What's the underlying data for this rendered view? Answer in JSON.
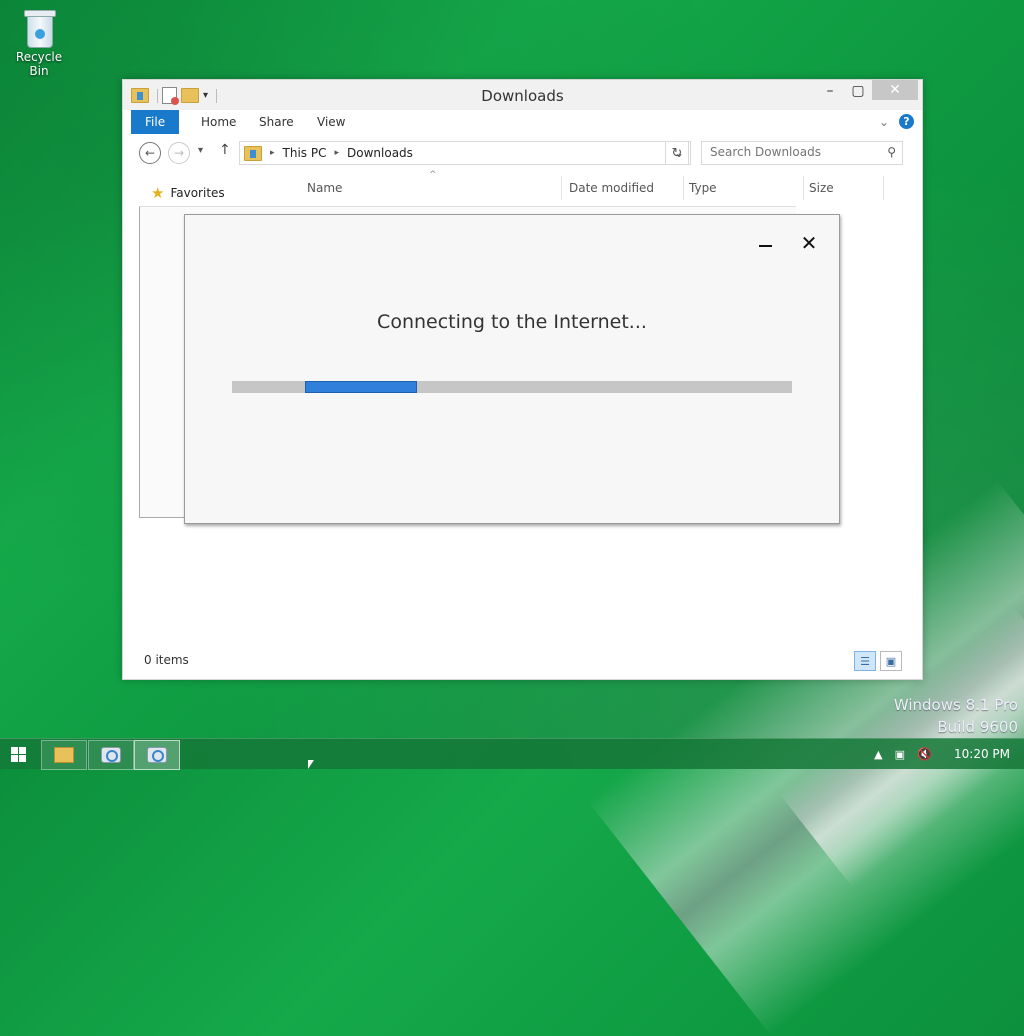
{
  "desktop": {
    "recycle_bin_label": "Recycle Bin",
    "watermark": [
      "Windows 8.1 Pro",
      "Build 9600"
    ]
  },
  "explorer": {
    "title": "Downloads",
    "tabs": {
      "file": "File",
      "home": "Home",
      "share": "Share",
      "view": "View"
    },
    "address": {
      "crumbs": [
        "This PC",
        "Downloads"
      ]
    },
    "search_placeholder": "Search Downloads",
    "nav": {
      "favorites": "Favorites"
    },
    "columns": [
      "Name",
      "Date modified",
      "Type",
      "Size"
    ],
    "status": "0 items"
  },
  "dialog": {
    "message": "Connecting to the Internet...",
    "progress": {
      "start": 0.13,
      "end": 0.33
    },
    "accent_color": "#2f7fdb"
  },
  "taskbar": {
    "clock": "10:20 PM",
    "items": [
      "file-explorer",
      "setup",
      "setup"
    ]
  }
}
